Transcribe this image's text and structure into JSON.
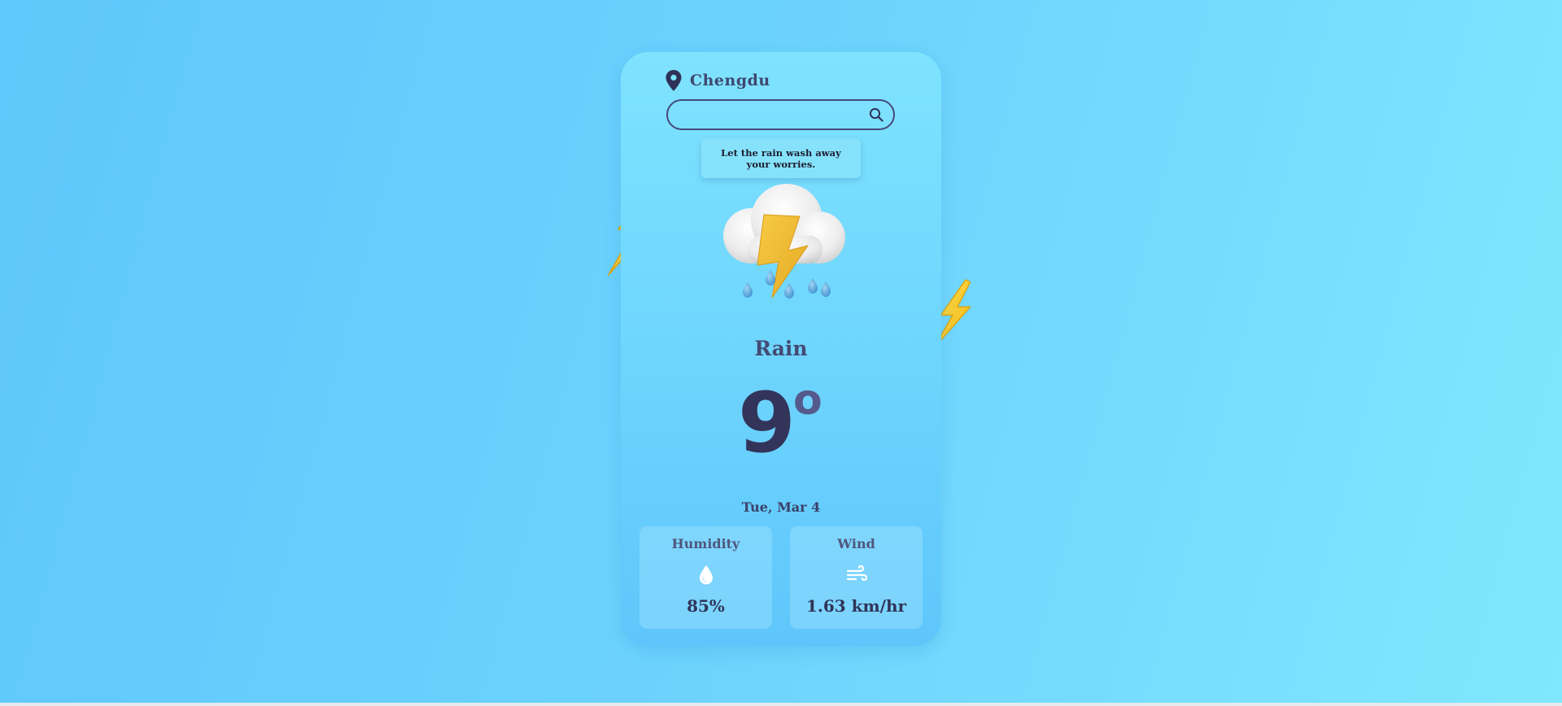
{
  "location": {
    "city": "Chengdu",
    "icon": "location-pin-icon"
  },
  "search": {
    "value": "",
    "placeholder": "",
    "icon": "search-icon"
  },
  "tooltip": {
    "text": "Let the rain wash away your worries."
  },
  "weather": {
    "icon": "thunderstorm-rain-icon",
    "condition": "Rain",
    "temperature": "9",
    "degree_symbol": "o",
    "date": "Tue, Mar 4"
  },
  "stats": {
    "humidity": {
      "label": "Humidity",
      "icon": "water-drop-icon",
      "value": "85%"
    },
    "wind": {
      "label": "Wind",
      "icon": "wind-icon",
      "value": "1.63 km/hr"
    }
  },
  "colors": {
    "background": "#6dd3fd",
    "card": "#6ed5fd",
    "text_dark": "#33345a",
    "bolt_yellow": "#f6c81a"
  }
}
